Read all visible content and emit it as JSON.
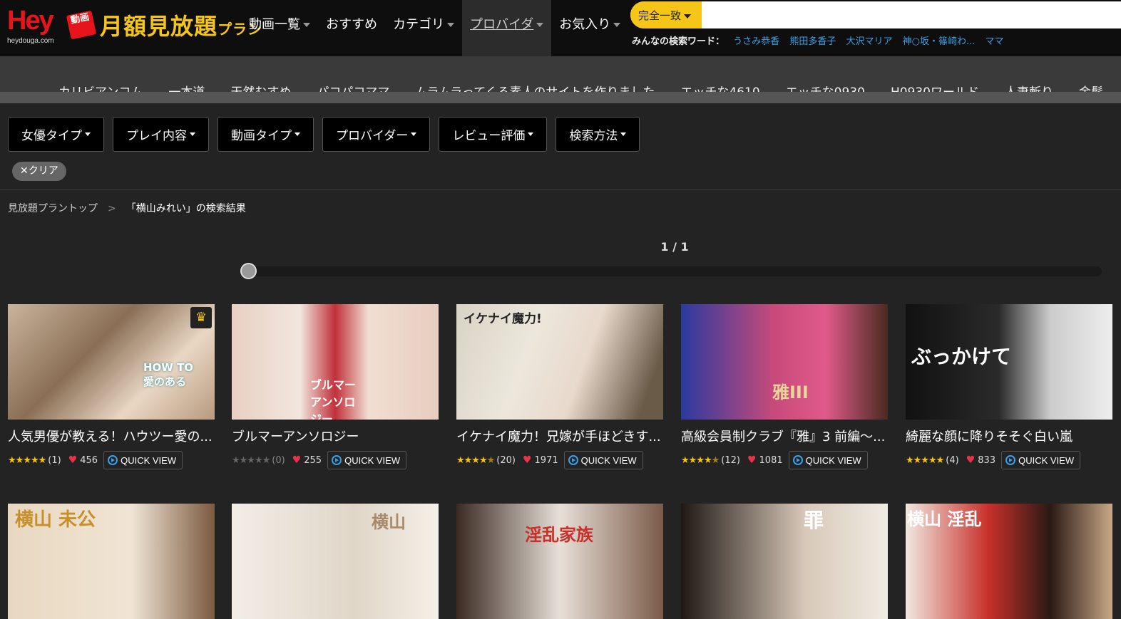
{
  "header": {
    "logo_text": "Hey",
    "logo_badge": "動画",
    "logo_domain": "heydouga.com",
    "plan_text": "月額見放題",
    "plan_suffix": "プラン",
    "nav": [
      {
        "label": "動画一覧",
        "caret": true
      },
      {
        "label": "おすすめ",
        "caret": false
      },
      {
        "label": "カテゴリ",
        "caret": true
      },
      {
        "label": "プロバイダ",
        "caret": true
      },
      {
        "label": "お気入り",
        "caret": true
      }
    ],
    "search_mode": "完全一致",
    "search_value": "",
    "popular_label": "みんなの検索ワード：",
    "popular_words": [
      "うさみ恭香",
      "熊田多香子",
      "大沢マリア",
      "神○坂・篠崎わ...",
      "ママ"
    ]
  },
  "providers": [
    "カリビアンコム",
    "一本道",
    "天然むすめ",
    "パコパコママ",
    "ムラムラってくる素人のサイトを作りました",
    "エッチな4610",
    "エッチな0930",
    "H0930ワールド",
    "人妻斬り",
    "金髪"
  ],
  "filters": [
    "女優タイプ",
    "プレイ内容",
    "動画タイプ",
    "プロバイダー",
    "レビュー評価",
    "検索方法"
  ],
  "clear_label": "✕クリア",
  "breadcrumb": {
    "home": "見放題プラントップ",
    "separator": ">",
    "current": "「横山みれい」の検索結果"
  },
  "pagination": {
    "label": "1 / 1"
  },
  "quick_view_label": "QUICK VIEW",
  "colors": {
    "accent": "#f5c518",
    "brand_red": "#e8141c",
    "link": "#3aa0e8",
    "heart": "#e8334a"
  },
  "cards": [
    {
      "title": "人気男優が教える！ハウツー愛の...",
      "rating": 5,
      "reviews": "(1)",
      "likes": "456",
      "crown": true,
      "overlay": "HOW TO 愛のある"
    },
    {
      "title": "ブルマーアンソロジー",
      "rating": 0,
      "reviews": "(0)",
      "likes": "255",
      "crown": false,
      "overlay": "ブルマー アンソロジー"
    },
    {
      "title": "イケナイ魔力！兄嫁が手ほどきす...",
      "rating": 4.5,
      "reviews": "(20)",
      "likes": "1971",
      "crown": false,
      "overlay": "イケナイ魔力!"
    },
    {
      "title": "高級会員制クラブ『雅』3 前編～...",
      "rating": 4.5,
      "reviews": "(12)",
      "likes": "1081",
      "crown": false,
      "overlay": "雅III"
    },
    {
      "title": "綺麗な顔に降りそそぐ白い嵐",
      "rating": 5,
      "reviews": "(4)",
      "likes": "833",
      "crown": false,
      "overlay": "ぶっかけて"
    }
  ],
  "cards_row2": [
    {
      "overlay": "横山 未公"
    },
    {
      "overlay": "横山"
    },
    {
      "overlay": "淫乱家族"
    },
    {
      "overlay": "罪"
    },
    {
      "overlay": "横山 淫乱"
    }
  ]
}
